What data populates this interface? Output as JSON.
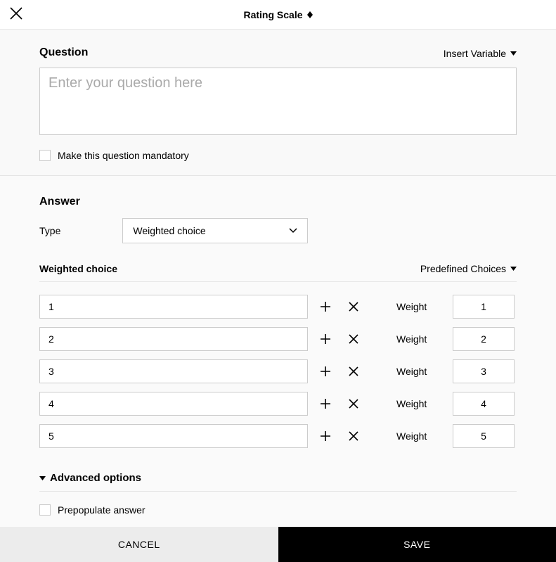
{
  "header": {
    "title": "Rating Scale"
  },
  "question": {
    "section_label": "Question",
    "insert_variable_label": "Insert Variable",
    "placeholder": "Enter your question here",
    "value": "",
    "mandatory_label": "Make this question mandatory"
  },
  "answer": {
    "section_label": "Answer",
    "type_label": "Type",
    "type_value": "Weighted choice",
    "weighted_choice_label": "Weighted choice",
    "predefined_choices_label": "Predefined Choices",
    "weight_label": "Weight",
    "choices": [
      {
        "label": "1",
        "weight": "1"
      },
      {
        "label": "2",
        "weight": "2"
      },
      {
        "label": "3",
        "weight": "3"
      },
      {
        "label": "4",
        "weight": "4"
      },
      {
        "label": "5",
        "weight": "5"
      }
    ],
    "advanced_options_label": "Advanced options",
    "prepopulate_label": "Prepopulate answer"
  },
  "footer": {
    "cancel": "CANCEL",
    "save": "SAVE"
  }
}
